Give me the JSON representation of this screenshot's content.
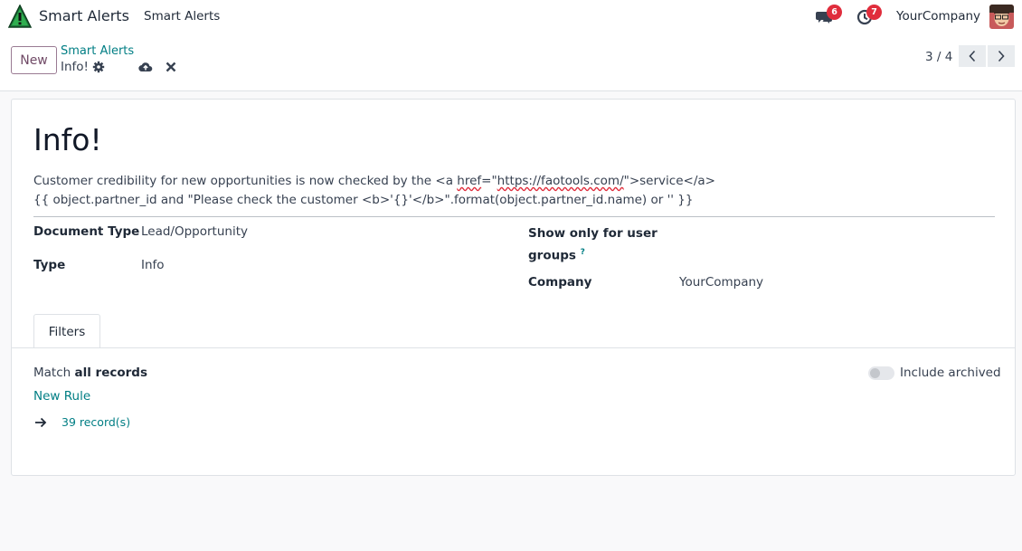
{
  "navbar": {
    "app_name": "Smart Alerts",
    "menu_item": "Smart Alerts",
    "messages_count": "6",
    "activities_count": "7",
    "company": "YourCompany"
  },
  "control_panel": {
    "new_label": "New",
    "breadcrumb_parent": "Smart Alerts",
    "breadcrumb_current": "Info!",
    "pager_value": "3 / 4"
  },
  "form": {
    "title": "Info!",
    "description": {
      "line1_a": "Customer credibility for new opportunities is now checked by the <a ",
      "line1_b": "href",
      "line1_c": "=\"",
      "line1_d": "https://faotools.com/",
      "line1_e": "\">service</a>",
      "line2": "{{ object.partner_id and \"Please check the customer <b>'{}'</b>\".format(object.partner_id.name) or '' }}"
    },
    "fields": {
      "document_type_label": "Document Type",
      "document_type_value": "Lead/Opportunity",
      "type_label": "Type",
      "type_value": "Info",
      "groups_label_1": "Show only for user",
      "groups_label_2": "groups",
      "groups_help": "?",
      "company_label": "Company",
      "company_value": "YourCompany"
    },
    "tabs": [
      "Filters"
    ],
    "filters": {
      "match_prefix": "Match ",
      "match_value": "all records",
      "include_archived": "Include archived",
      "new_rule": "New Rule",
      "records": "39 record(s)"
    }
  },
  "colors": {
    "brand": "#714b67",
    "link": "#017e84",
    "badge": "#e02d3c"
  }
}
